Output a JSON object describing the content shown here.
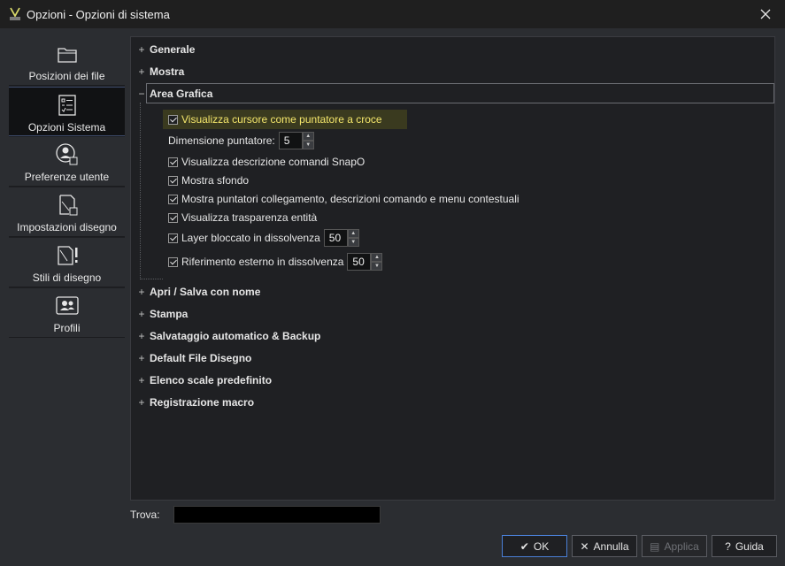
{
  "window": {
    "title": "Opzioni - Opzioni di sistema"
  },
  "sidebar": {
    "items": [
      {
        "label": "Posizioni dei file",
        "icon": "folder-icon",
        "active": false
      },
      {
        "label": "Opzioni Sistema",
        "icon": "checklist-icon",
        "active": true
      },
      {
        "label": "Preferenze utente",
        "icon": "user-settings-icon",
        "active": false
      },
      {
        "label": "Impostazioni disegno",
        "icon": "drawing-settings-icon",
        "active": false
      },
      {
        "label": "Stili di disegno",
        "icon": "drawing-styles-icon",
        "active": false
      },
      {
        "label": "Profili",
        "icon": "profile-icon",
        "active": false
      }
    ]
  },
  "tree": {
    "nodes_top": [
      {
        "label": "Generale",
        "expander": "+"
      },
      {
        "label": "Mostra",
        "expander": "+"
      }
    ],
    "open_node": {
      "label": "Area Grafica",
      "expander": "−"
    },
    "open_children": {
      "cursor_crosshair": "Visualizza cursore come puntatore a croce",
      "pointer_size_label": "Dimensione puntatore:",
      "pointer_size_value": "5",
      "snapo_desc": "Visualizza descrizione comandi SnapO",
      "show_background": "Mostra sfondo",
      "link_pointers": "Mostra puntatori collegamento, descrizioni comando e menu contestuali",
      "entity_transparency": "Visualizza trasparenza entità",
      "locked_layer_fade": "Layer bloccato in dissolvenza",
      "locked_layer_fade_value": "50",
      "xref_fade": "Riferimento esterno in dissolvenza",
      "xref_fade_value": "50"
    },
    "nodes_bottom": [
      {
        "label": "Apri / Salva con nome",
        "expander": "+"
      },
      {
        "label": "Stampa",
        "expander": "+"
      },
      {
        "label": "Salvataggio automatico & Backup",
        "expander": "+"
      },
      {
        "label": "Default File Disegno",
        "expander": "+"
      },
      {
        "label": "Elenco scale predefinito",
        "expander": "+"
      },
      {
        "label": "Registrazione macro",
        "expander": "+"
      }
    ]
  },
  "search": {
    "label": "Trova:",
    "value": ""
  },
  "buttons": {
    "ok": "OK",
    "cancel": "Annulla",
    "apply": "Applica",
    "help": "Guida",
    "help_glyph": "?"
  },
  "colors": {
    "accent": "#4a7fd6",
    "highlight_text": "#f4e66b",
    "background": "#2b2d31"
  }
}
